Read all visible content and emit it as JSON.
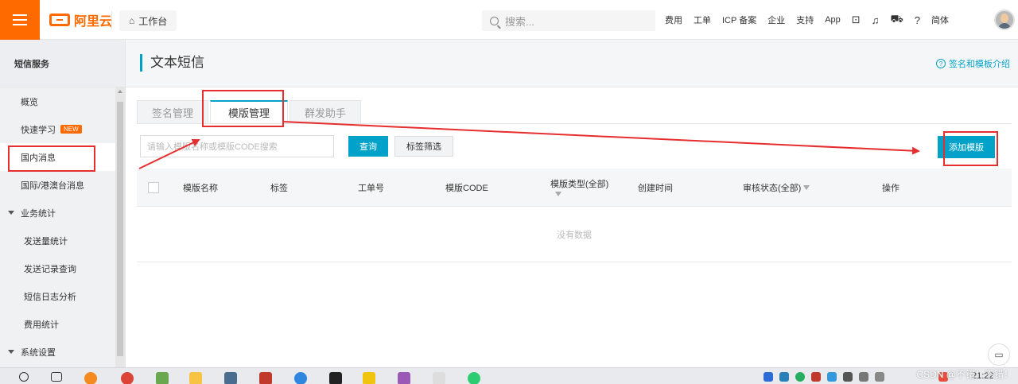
{
  "header": {
    "logo_text": "阿里云",
    "workbench_label": "工作台",
    "search_placeholder": "搜索...",
    "nav": [
      "费用",
      "工单",
      "ICP 备案",
      "企业",
      "支持",
      "App"
    ],
    "lang": "简体"
  },
  "sidebar": {
    "title": "短信服务",
    "items": [
      {
        "label": "概览"
      },
      {
        "label": "快速学习",
        "badge": "NEW"
      },
      {
        "label": "国内消息"
      },
      {
        "label": "国际/港澳台消息"
      },
      {
        "label": "业务统计"
      },
      {
        "label": "发送量统计"
      },
      {
        "label": "发送记录查询"
      },
      {
        "label": "短信日志分析"
      },
      {
        "label": "费用统计"
      },
      {
        "label": "系统设置"
      }
    ]
  },
  "main": {
    "title": "文本短信",
    "help_link": "签名和模板介绍",
    "tabs": [
      "签名管理",
      "模版管理",
      "群发助手"
    ],
    "filter_placeholder": "请输入模版名称或模版CODE搜索",
    "query_button": "查询",
    "tag_filter_button": "标签筛选",
    "add_button": "添加模版",
    "columns": [
      "模版名称",
      "标签",
      "工单号",
      "模版CODE",
      "模版类型(全部)",
      "创建时间",
      "审核状态(全部)",
      "操作"
    ],
    "empty_text": "没有数据"
  },
  "taskbar": {
    "time": "21:22",
    "watermark": "CSDN @不错！不错！"
  },
  "colors": {
    "brand_orange": "#ff6a00",
    "accent_blue": "#00a2ca",
    "annotation_red": "#e62e2e"
  }
}
